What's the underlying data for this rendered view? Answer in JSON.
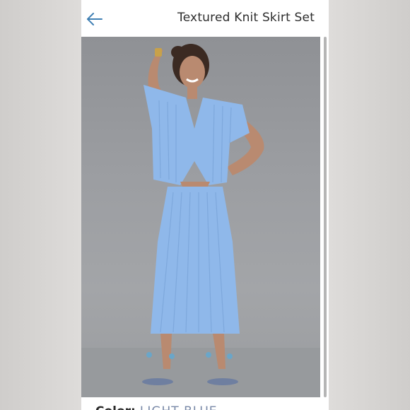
{
  "header": {
    "title": "Textured Knit Skirt Set",
    "back_icon": "arrow-left-icon"
  },
  "product": {
    "image_subject": "model-wearing-blue-knit-set",
    "color_label": "Color:",
    "color_value": "LIGHT BLUE"
  },
  "colors": {
    "accent": "#3f7fb3",
    "garment": "#8fb8ea",
    "background": "#9c9ea2"
  }
}
